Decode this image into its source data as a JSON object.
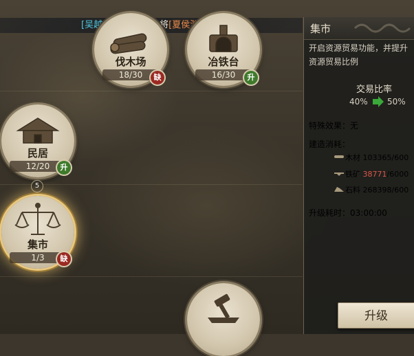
{
  "banner": {
    "name1": "[吴越春秋]",
    "mid": "招募到名将",
    "name2": "[夏侯渊]"
  },
  "buildings": [
    {
      "name": "伐木场",
      "level": "18/30",
      "badge": "缺"
    },
    {
      "name": "冶铁台",
      "level": "16/30",
      "badge": "升"
    },
    {
      "name": "民居",
      "level": "12/20",
      "badge": "升"
    },
    {
      "name": "集市",
      "level": "1/3",
      "badge": "缺"
    }
  ],
  "unlock_count": "5",
  "panel": {
    "title": "集市",
    "description": "开启资源贸易功能，并提升资源贸易比例",
    "rate_label": "交易比率",
    "rate_from": "40%",
    "rate_to": "50%",
    "special_label": "特殊效果：",
    "special_value": "无",
    "cost_label": "建造消耗：",
    "costs": [
      {
        "name": "木材",
        "have": "103365",
        "need": "/600"
      },
      {
        "name": "铁矿",
        "have": "38771",
        "need": "/6000"
      },
      {
        "name": "石料",
        "have": "268398",
        "need": "/600"
      }
    ],
    "time_label": "升级耗时：",
    "time_value": "03:00:00",
    "upgrade_button": "升级"
  },
  "colors": {
    "cyan": "#4fc6e0",
    "orange": "#e88a4a",
    "insufficient": "#d9574a",
    "badge_red": "#9a2a22",
    "badge_green": "#3f7a2c"
  }
}
